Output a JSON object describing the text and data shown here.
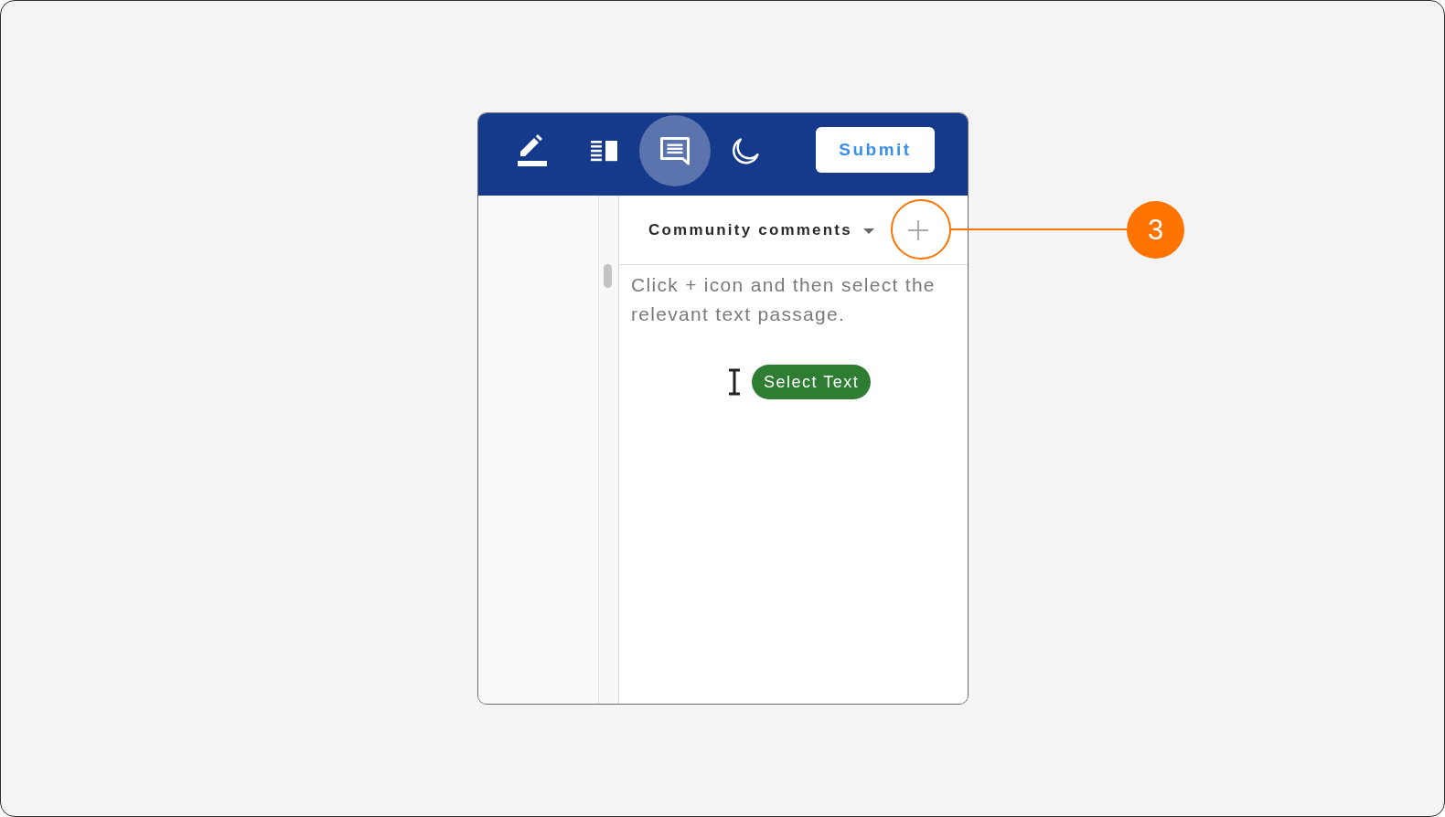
{
  "toolbar": {
    "tools": [
      {
        "kind": "pencil",
        "selected": false
      },
      {
        "kind": "columns",
        "selected": false
      },
      {
        "kind": "comments",
        "selected": true
      },
      {
        "kind": "moon",
        "selected": false
      }
    ],
    "submit_button": "Submit"
  },
  "comments_panel": {
    "filter_dropdown": "Community comments",
    "instruction": "Click + icon and then select the relevant text passage.",
    "select_text_tooltip": "Select Text"
  },
  "callout": {
    "number": "3"
  }
}
